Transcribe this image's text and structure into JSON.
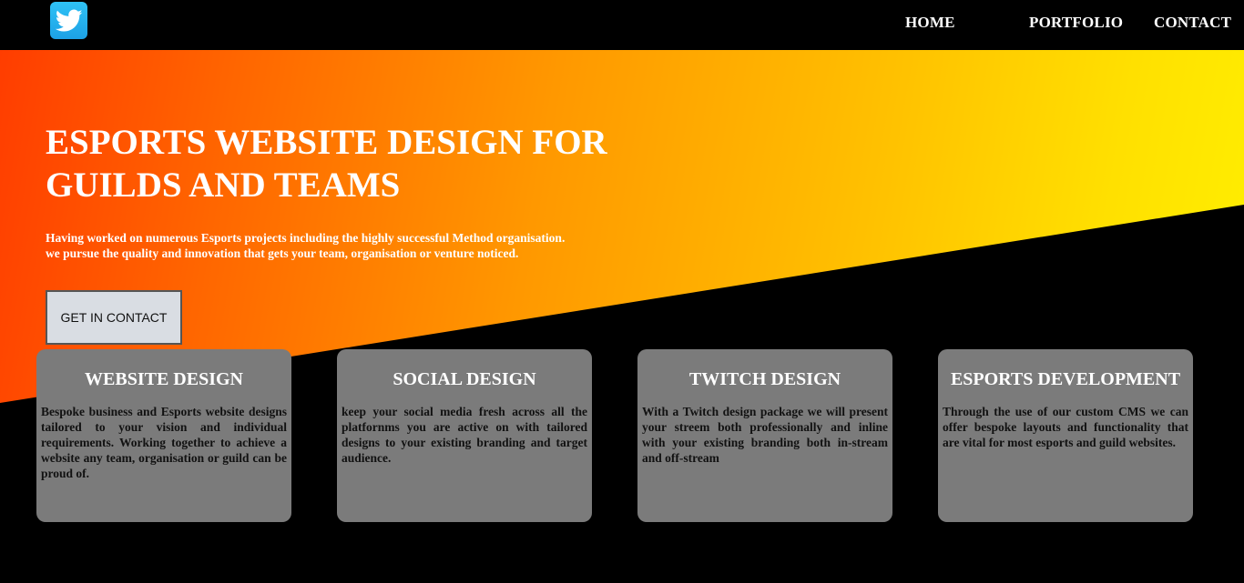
{
  "header": {
    "logo_icon": "twitter-bird-icon",
    "nav": [
      {
        "label": "HOME"
      },
      {
        "label": "PORTFOLIO"
      },
      {
        "label": "CONTACT"
      }
    ]
  },
  "hero": {
    "title": "ESPORTS WEBSITE DESIGN FOR GUILDS AND TEAMS",
    "description": "Having worked on numerous Esports projects including the highly successful Method organisation. we pursue the quality and innovation that gets your team, organisation or venture noticed.",
    "cta_label": "GET IN CONTACT",
    "gradient_colors": [
      "#ff3d00",
      "#ff9800",
      "#ffc200",
      "#fff200"
    ]
  },
  "services": [
    {
      "title": "WEBSITE DESIGN",
      "text": "Bespoke business and Esports website designs tailored to your vision and individual requirements. Working together to achieve a website any team, organisation or guild can be proud of."
    },
    {
      "title": "SOCIAL DESIGN",
      "text": "keep your social media fresh across all the platfornms you are active on with tailored designs to your existing branding and target audience."
    },
    {
      "title": "TWITCH DESIGN",
      "text": "With a Twitch design package we will present your streem both professionally and inline with your existing branding both in-stream and off-stream"
    },
    {
      "title": "ESPORTS DEVELOPMENT",
      "text": "Through the use of our custom CMS we can offer bespoke layouts and functionality that are vital for most esports and guild websites."
    }
  ]
}
